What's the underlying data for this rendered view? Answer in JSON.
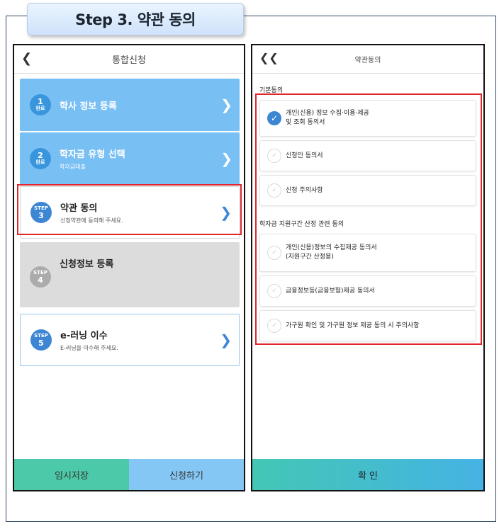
{
  "banner": {
    "title": "Step 3. 약관 동의"
  },
  "left_screen": {
    "back_icon": "chevron-left-icon",
    "title": "통합신청",
    "steps": [
      {
        "badge_top": "1",
        "badge_bottom": "완료",
        "title": "학사 정보 등록",
        "subtitle": "",
        "state": "done"
      },
      {
        "badge_top": "2",
        "badge_bottom": "완료",
        "title": "학자금 유형 선택",
        "subtitle": "학자금대출",
        "state": "done"
      },
      {
        "badge_top": "STEP",
        "badge_bottom": "3",
        "title": "약관 동의",
        "subtitle": "신청약관에 동의해 주세요.",
        "state": "current"
      },
      {
        "badge_top": "STEP",
        "badge_bottom": "4",
        "title": "신청정보 등록",
        "subtitle": "",
        "state": "pending"
      },
      {
        "badge_top": "STEP",
        "badge_bottom": "5",
        "title": "e-러닝 이수",
        "subtitle": "E-러닝을 이수해 주세요.",
        "state": "next"
      }
    ],
    "save_label": "임시저장",
    "apply_label": "신청하기"
  },
  "right_screen": {
    "back_icon": "double-chevron-left-icon",
    "title": "약관동의",
    "section1_title": "기본동의",
    "section1_items": [
      {
        "line1": "개인(신용) 정보 수집·이용·제공",
        "line2": "및 조회 동의서",
        "checked": true
      },
      {
        "line1": "신청인 동의서",
        "line2": "",
        "checked": false
      },
      {
        "line1": "신청 주의사항",
        "line2": "",
        "checked": false
      }
    ],
    "section2_title": "학자금 지원구간 산정 관련 동의",
    "section2_items": [
      {
        "line1": "개인(신용)정보의 수집제공 동의서",
        "line2": "(지원구간 산정용)",
        "checked": false
      },
      {
        "line1": "금융정보등(금융보험)제공 동의서",
        "line2": "",
        "checked": false
      },
      {
        "line1": "가구원 확인 및 가구원 정보 제공 동의 시 주의사항",
        "line2": "",
        "checked": false
      }
    ],
    "confirm_label": "확 인"
  },
  "colors": {
    "highlight_red": "#e0262b",
    "done_card": "#78bff4",
    "accent_blue": "#3d86d4",
    "save_green": "#4cc9a8",
    "apply_blue": "#84c7f4"
  }
}
